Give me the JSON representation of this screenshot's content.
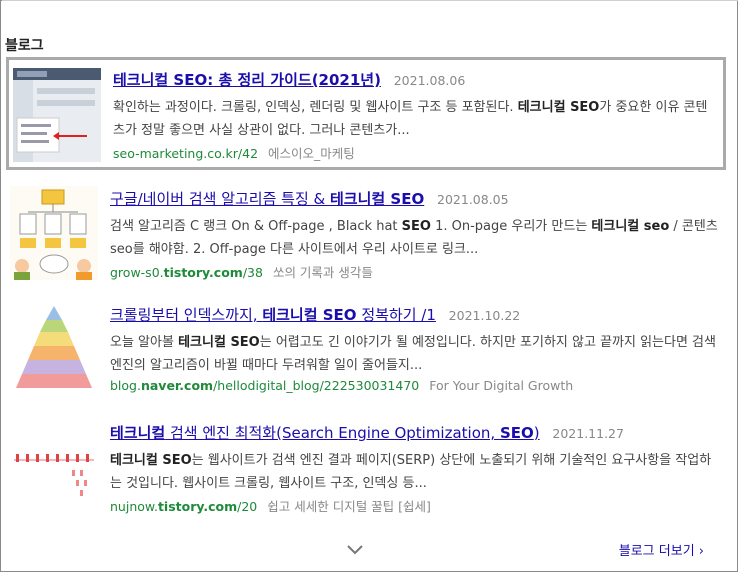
{
  "section": {
    "title": "블로그"
  },
  "results": [
    {
      "title": "테크니컬 SEO: 총 정리 가이드(2021년)",
      "date": "2021.08.06",
      "snippet_1": "확인하는 과정이다. 크롤링, 인덱싱, 렌더링 및 웹사이트 구조 등 포함된다. ",
      "snippet_2": "테크니컬 SEO",
      "snippet_3": "가 중요한 이유 콘텐츠가 정말 좋으면 사실 상관이 없다. 그러나 콘텐츠가...",
      "url": "seo-marketing.co.kr/42",
      "source": "에스이오_마케팅"
    },
    {
      "title_1": "구글/네이버 검색 알고리즘 특징 & ",
      "title_2": "테크니컬 SEO",
      "date": "2021.08.05",
      "snippet_1": "검색 알고리즘 C 랭크 On & Off-page , Black hat ",
      "snippet_2": "SEO",
      "snippet_3": " 1. On-page 우리가 만드는 ",
      "snippet_4": "테크니컬 seo",
      "snippet_5": " / 콘텐츠seo를 해야함. 2. Off-page 다른 사이트에서 우리 사이트로 링크...",
      "url_1": "grow-s0.",
      "url_2": "tistory.com",
      "url_3": "/38",
      "source": "쏘의 기록과 생각들"
    },
    {
      "title_1": "크롤링부터 인덱스까지, ",
      "title_2": "테크니컬 SEO",
      "title_3": " 정복하기 /1",
      "date": "2021.10.22",
      "snippet_1": "오늘 알아볼 ",
      "snippet_2": "테크니컬 SEO",
      "snippet_3": "는 어렵고도 긴 이야기가 될 예정입니다. 하지만 포기하지 않고 끝까지 읽는다면 검색엔진의 알고리즘이 바뀔 때마다 두려워할 일이 줄어들지...",
      "url_1": "blog.",
      "url_2": "naver.com",
      "url_3": "/hellodigital_blog/222530031470",
      "source": "For Your Digital Growth"
    },
    {
      "title_1": "테크니컬",
      "title_2": " 검색 엔진 최적화(Search Engine Optimization, ",
      "title_3": "SEO",
      "title_4": ")",
      "date": "2021.11.27",
      "snippet_1": "테크니컬 SEO",
      "snippet_2": "는 웹사이트가 검색 엔진 결과 페이지(SERP) 상단에 노출되기 위해 기술적인 요구사항을 작업하는 것입니다. 웹사이트 크롤링, 웹사이트 구조, 인덱싱 등...",
      "url_1": "nujnow.",
      "url_2": "tistory.com",
      "url_3": "/20",
      "source": "쉽고 세세한 디지털 꿀팁 [쉽세]"
    }
  ],
  "footer": {
    "more_label": "블로그 더보기 ›"
  },
  "icons": {
    "expand": "chevron-down-icon"
  },
  "colors": {
    "link": "#1a0dab",
    "url": "#1e8a3a",
    "meta": "#888888",
    "highlight_border": "#aaaaaa"
  }
}
